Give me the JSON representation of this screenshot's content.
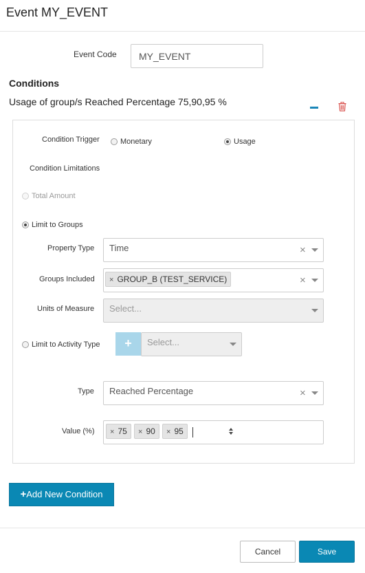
{
  "modal": {
    "title": "Event MY_EVENT"
  },
  "event_code": {
    "label": "Event Code",
    "value": "MY_EVENT"
  },
  "conditions": {
    "heading": "Conditions",
    "summary": "Usage of group/s Reached Percentage 75,90,95 %"
  },
  "condition": {
    "trigger_label": "Condition Trigger",
    "trigger_options": [
      "Monetary",
      "Usage"
    ],
    "trigger_selected": "Usage",
    "limitations_label": "Condition Limitations",
    "total_amount_label": "Total Amount",
    "limit_groups_label": "Limit to Groups",
    "property_type": {
      "label": "Property Type",
      "value": "Time"
    },
    "groups_included": {
      "label": "Groups Included",
      "chips": [
        "GROUP_B (TEST_SERVICE)"
      ]
    },
    "units_of_measure": {
      "label": "Units of Measure",
      "placeholder": "Select..."
    },
    "limit_activity_label": "Limit to Activity Type",
    "activity_placeholder": "Select...",
    "type": {
      "label": "Type",
      "value": "Reached Percentage"
    },
    "value_pct": {
      "label": "Value (%)",
      "chips": [
        "75",
        "90",
        "95"
      ]
    }
  },
  "actions": {
    "add_condition": "Add New Condition",
    "cancel": "Cancel",
    "save": "Save"
  },
  "icons": {
    "remove_bar": "minus-icon",
    "delete": "trash-icon",
    "plus": "plus-icon",
    "clear": "clear-x-icon",
    "dropdown": "caret-down-icon",
    "stepper": "spinner-arrows-icon"
  },
  "colors": {
    "primary": "#0a88b4",
    "minus_icon": "#1a86b8",
    "trash_icon": "#d9534f",
    "plus_tile": "#a9d6ea"
  }
}
